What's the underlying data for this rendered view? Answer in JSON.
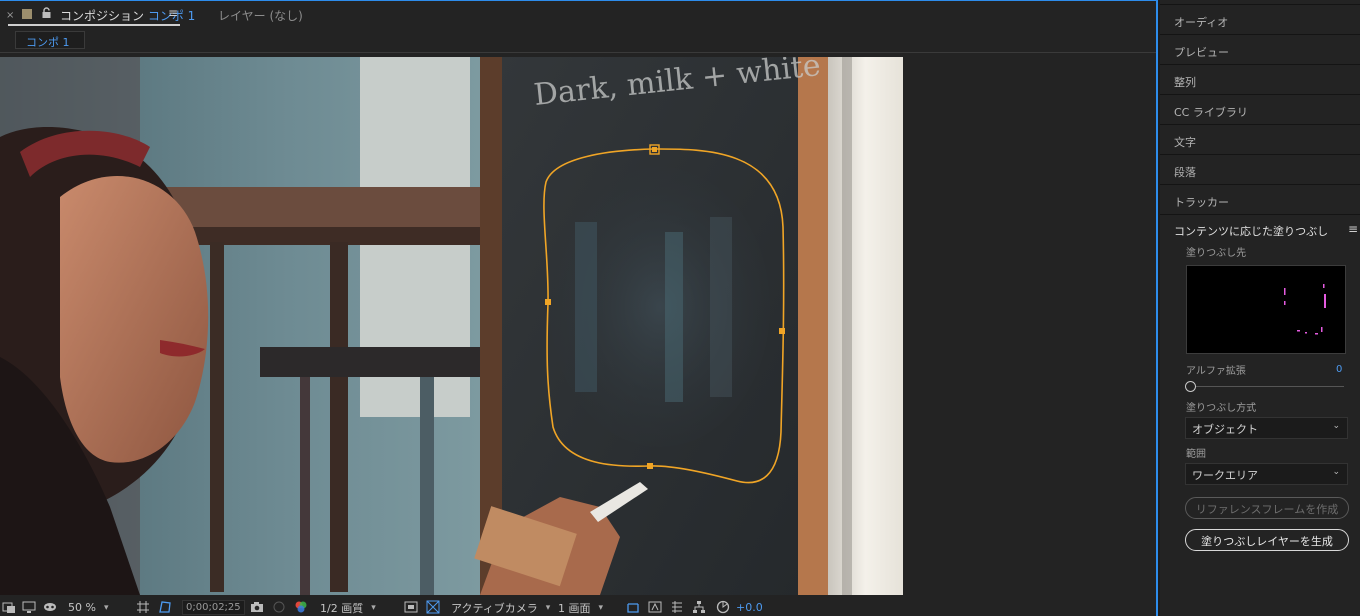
{
  "composition_panel": {
    "close_glyph": "×",
    "tab_prefix": "コンポジション",
    "tab_name": "コンポ 1",
    "tab_menu_glyph": "≡",
    "layer_tab": "レイヤー (なし)",
    "comp_pill": "コンポ 1"
  },
  "toolbar": {
    "zoom": "50 %",
    "timecode": "0;00;02;25",
    "resolution": "1/2 画質",
    "camera": "アクティブカメラ",
    "views": "1 画面",
    "exposure": "+0.0"
  },
  "footage": {
    "chalkboard_text": "Dark, milk + white choc"
  },
  "right_panel": {
    "items": [
      "オーディオ",
      "プレビュー",
      "整列",
      "CC ライブラリ",
      "文字",
      "段落",
      "トラッカー"
    ],
    "caf_title": "コンテンツに応じた塗りつぶし",
    "caf_menu_glyph": "≡",
    "fill_target_label": "塗りつぶし先",
    "alpha_label": "アルファ拡張",
    "alpha_value": "0",
    "fill_method_label": "塗りつぶし方式",
    "fill_method_value": "オブジェクト",
    "range_label": "範囲",
    "range_value": "ワークエリア",
    "ref_frame_button": "リファレンスフレームを作成",
    "generate_button": "塗りつぶしレイヤーを生成"
  },
  "colors": {
    "accent": "#4d9af0",
    "mask": "#f0a526",
    "panel": "#232323"
  }
}
